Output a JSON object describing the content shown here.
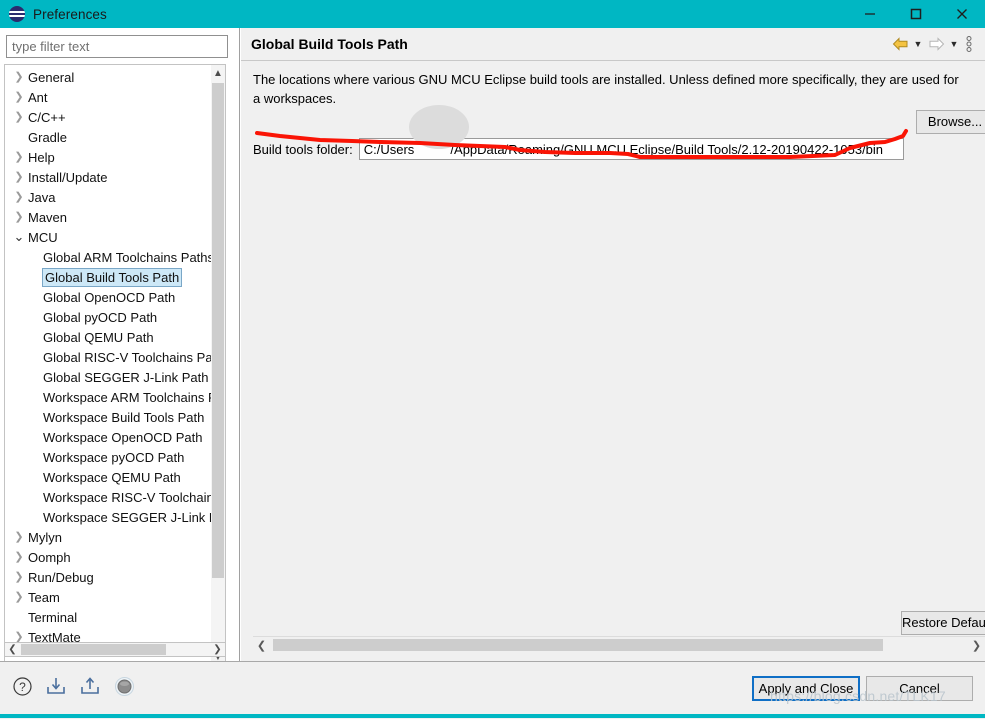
{
  "window": {
    "title": "Preferences",
    "icon": "eclipse-icon",
    "titlebar_color": "#00b7c3",
    "controls": [
      {
        "name": "minimize",
        "glyph": "minimize-icon"
      },
      {
        "name": "maximize",
        "glyph": "maximize-icon"
      },
      {
        "name": "close",
        "glyph": "close-icon"
      }
    ]
  },
  "sidebar": {
    "filter": {
      "placeholder": "type filter text",
      "value": ""
    },
    "items": [
      {
        "label": "General",
        "level": 0,
        "expandable": true,
        "expanded": false,
        "selected": false
      },
      {
        "label": "Ant",
        "level": 0,
        "expandable": true,
        "expanded": false,
        "selected": false
      },
      {
        "label": "C/C++",
        "level": 0,
        "expandable": true,
        "expanded": false,
        "selected": false
      },
      {
        "label": "Gradle",
        "level": 0,
        "expandable": false,
        "expanded": false,
        "selected": false
      },
      {
        "label": "Help",
        "level": 0,
        "expandable": true,
        "expanded": false,
        "selected": false
      },
      {
        "label": "Install/Update",
        "level": 0,
        "expandable": true,
        "expanded": false,
        "selected": false
      },
      {
        "label": "Java",
        "level": 0,
        "expandable": true,
        "expanded": false,
        "selected": false
      },
      {
        "label": "Maven",
        "level": 0,
        "expandable": true,
        "expanded": false,
        "selected": false
      },
      {
        "label": "MCU",
        "level": 0,
        "expandable": true,
        "expanded": true,
        "selected": false
      },
      {
        "label": "Global ARM Toolchains Paths",
        "level": 1,
        "expandable": false,
        "expanded": false,
        "selected": false
      },
      {
        "label": "Global Build Tools Path",
        "level": 1,
        "expandable": false,
        "expanded": false,
        "selected": true
      },
      {
        "label": "Global OpenOCD Path",
        "level": 1,
        "expandable": false,
        "expanded": false,
        "selected": false
      },
      {
        "label": "Global pyOCD Path",
        "level": 1,
        "expandable": false,
        "expanded": false,
        "selected": false
      },
      {
        "label": "Global QEMU Path",
        "level": 1,
        "expandable": false,
        "expanded": false,
        "selected": false
      },
      {
        "label": "Global RISC-V Toolchains Paths",
        "level": 1,
        "expandable": false,
        "expanded": false,
        "selected": false
      },
      {
        "label": "Global SEGGER J-Link Path",
        "level": 1,
        "expandable": false,
        "expanded": false,
        "selected": false
      },
      {
        "label": "Workspace ARM Toolchains Paths",
        "level": 1,
        "expandable": false,
        "expanded": false,
        "selected": false
      },
      {
        "label": "Workspace Build Tools Path",
        "level": 1,
        "expandable": false,
        "expanded": false,
        "selected": false
      },
      {
        "label": "Workspace OpenOCD Path",
        "level": 1,
        "expandable": false,
        "expanded": false,
        "selected": false
      },
      {
        "label": "Workspace pyOCD Path",
        "level": 1,
        "expandable": false,
        "expanded": false,
        "selected": false
      },
      {
        "label": "Workspace QEMU Path",
        "level": 1,
        "expandable": false,
        "expanded": false,
        "selected": false
      },
      {
        "label": "Workspace RISC-V Toolchains Paths",
        "level": 1,
        "expandable": false,
        "expanded": false,
        "selected": false
      },
      {
        "label": "Workspace SEGGER J-Link Path",
        "level": 1,
        "expandable": false,
        "expanded": false,
        "selected": false
      },
      {
        "label": "Mylyn",
        "level": 0,
        "expandable": true,
        "expanded": false,
        "selected": false
      },
      {
        "label": "Oomph",
        "level": 0,
        "expandable": true,
        "expanded": false,
        "selected": false
      },
      {
        "label": "Run/Debug",
        "level": 0,
        "expandable": true,
        "expanded": false,
        "selected": false
      },
      {
        "label": "Team",
        "level": 0,
        "expandable": true,
        "expanded": false,
        "selected": false
      },
      {
        "label": "Terminal",
        "level": 0,
        "expandable": false,
        "expanded": false,
        "selected": false
      },
      {
        "label": "TextMate",
        "level": 0,
        "expandable": true,
        "expanded": false,
        "selected": false
      }
    ],
    "expand_glyph": "❯",
    "collapse_glyph": "⌄"
  },
  "page": {
    "title": "Global Build Tools Path",
    "description": "The locations where various GNU MCU Eclipse build tools are installed. Unless defined more specifically, they are used for a workspaces.",
    "header_tools": [
      {
        "name": "back-arrow-icon"
      },
      {
        "name": "back-dropdown-caret-icon"
      },
      {
        "name": "forward-arrow-icon"
      },
      {
        "name": "forward-dropdown-caret-icon"
      },
      {
        "name": "view-menu-dots-icon"
      }
    ],
    "field": {
      "label": "Build tools folder:",
      "value": "C:/Users          /AppData/Roaming/GNU MCU Eclipse/Build Tools/2.12-20190422-1053/bin",
      "placeholder": ""
    },
    "browse_label": "Browse...",
    "restore_defaults_label": "Restore Defaults"
  },
  "footer": {
    "icons": [
      {
        "name": "help-icon"
      },
      {
        "name": "import-preferences-icon"
      },
      {
        "name": "export-preferences-icon"
      },
      {
        "name": "sphere-icon"
      }
    ],
    "apply_and_close_label": "Apply and Close",
    "cancel_label": "Cancel"
  },
  "annotation": {
    "color": "#fa1405",
    "watermark": "https://blog.csdn.net/TLK17"
  }
}
